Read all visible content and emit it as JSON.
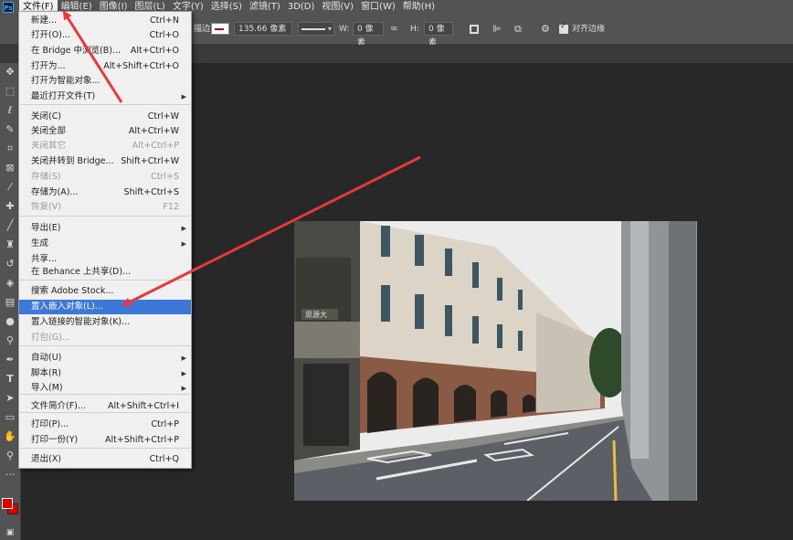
{
  "app": {
    "logo": "Ps"
  },
  "menubar": [
    "文件(F)",
    "编辑(E)",
    "图像(I)",
    "图层(L)",
    "文字(Y)",
    "选择(S)",
    "滤镜(T)",
    "3D(D)",
    "视图(V)",
    "窗口(W)",
    "帮助(H)"
  ],
  "options": {
    "stroke_label": "描边:",
    "stroke_size": "135.66 像素",
    "w_label": "W:",
    "w_value": "0 像素",
    "h_label": "H:",
    "h_value": "0 像素",
    "align_edges": "对齐边缘"
  },
  "file_menu": {
    "items": [
      {
        "label": "新建...",
        "shortcut": "Ctrl+N",
        "disabled": false
      },
      {
        "label": "打开(O)...",
        "shortcut": "Ctrl+O",
        "disabled": false
      },
      {
        "label": "在 Bridge 中浏览(B)...",
        "shortcut": "Alt+Ctrl+O",
        "disabled": false
      },
      {
        "label": "打开为...",
        "shortcut": "Alt+Shift+Ctrl+O",
        "disabled": false
      },
      {
        "label": "打开为智能对象...",
        "shortcut": "",
        "disabled": false
      },
      {
        "label": "最近打开文件(T)",
        "shortcut": "",
        "submenu": true,
        "disabled": false
      },
      {
        "label": "关闭(C)",
        "shortcut": "Ctrl+W",
        "disabled": false
      },
      {
        "label": "关闭全部",
        "shortcut": "Alt+Ctrl+W",
        "disabled": false
      },
      {
        "label": "关闭其它",
        "shortcut": "Alt+Ctrl+P",
        "disabled": true
      },
      {
        "label": "关闭并转到 Bridge...",
        "shortcut": "Shift+Ctrl+W",
        "disabled": false
      },
      {
        "label": "存储(S)",
        "shortcut": "Ctrl+S",
        "disabled": true
      },
      {
        "label": "存储为(A)...",
        "shortcut": "Shift+Ctrl+S",
        "disabled": false
      },
      {
        "label": "恢复(V)",
        "shortcut": "F12",
        "disabled": true
      },
      {
        "label": "导出(E)",
        "shortcut": "",
        "submenu": true,
        "disabled": false
      },
      {
        "label": "生成",
        "shortcut": "",
        "submenu": true,
        "disabled": false
      },
      {
        "label": "共享...",
        "shortcut": "",
        "disabled": false
      },
      {
        "label": "在 Behance 上共享(D)...",
        "shortcut": "",
        "disabled": false
      },
      {
        "label": "搜索 Adobe Stock...",
        "shortcut": "",
        "disabled": false
      },
      {
        "label": "置入嵌入对象(L)...",
        "shortcut": "",
        "disabled": false,
        "highlighted": true
      },
      {
        "label": "置入链接的智能对象(K)...",
        "shortcut": "",
        "disabled": false
      },
      {
        "label": "打包(G)...",
        "shortcut": "",
        "disabled": true
      },
      {
        "label": "自动(U)",
        "shortcut": "",
        "submenu": true,
        "disabled": false
      },
      {
        "label": "脚本(R)",
        "shortcut": "",
        "submenu": true,
        "disabled": false
      },
      {
        "label": "导入(M)",
        "shortcut": "",
        "submenu": true,
        "disabled": false
      },
      {
        "label": "文件简介(F)...",
        "shortcut": "Alt+Shift+Ctrl+I",
        "disabled": false
      },
      {
        "label": "打印(P)...",
        "shortcut": "Ctrl+P",
        "disabled": false
      },
      {
        "label": "打印一份(Y)",
        "shortcut": "Alt+Shift+Ctrl+P",
        "disabled": false
      },
      {
        "label": "退出(X)",
        "shortcut": "Ctrl+Q",
        "disabled": false
      }
    ]
  },
  "tools": [
    "move-tool-icon",
    "marquee-tool-icon",
    "lasso-tool-icon",
    "quick-select-tool-icon",
    "crop-tool-icon",
    "frame-tool-icon",
    "eyedropper-tool-icon",
    "healing-brush-icon",
    "brush-tool-icon",
    "clone-stamp-icon",
    "history-brush-icon",
    "eraser-tool-icon",
    "gradient-tool-icon",
    "blur-tool-icon",
    "dodge-tool-icon",
    "pen-tool-icon",
    "type-tool-icon",
    "path-select-icon",
    "shape-tool-icon",
    "hand-tool-icon",
    "zoom-tool-icon"
  ],
  "colors": {
    "foreground": "#e00000",
    "background": "#e00000",
    "highlight": "#3b78d8",
    "arrow": "#e8383a"
  },
  "photo": {
    "sign_text": "思源大"
  }
}
